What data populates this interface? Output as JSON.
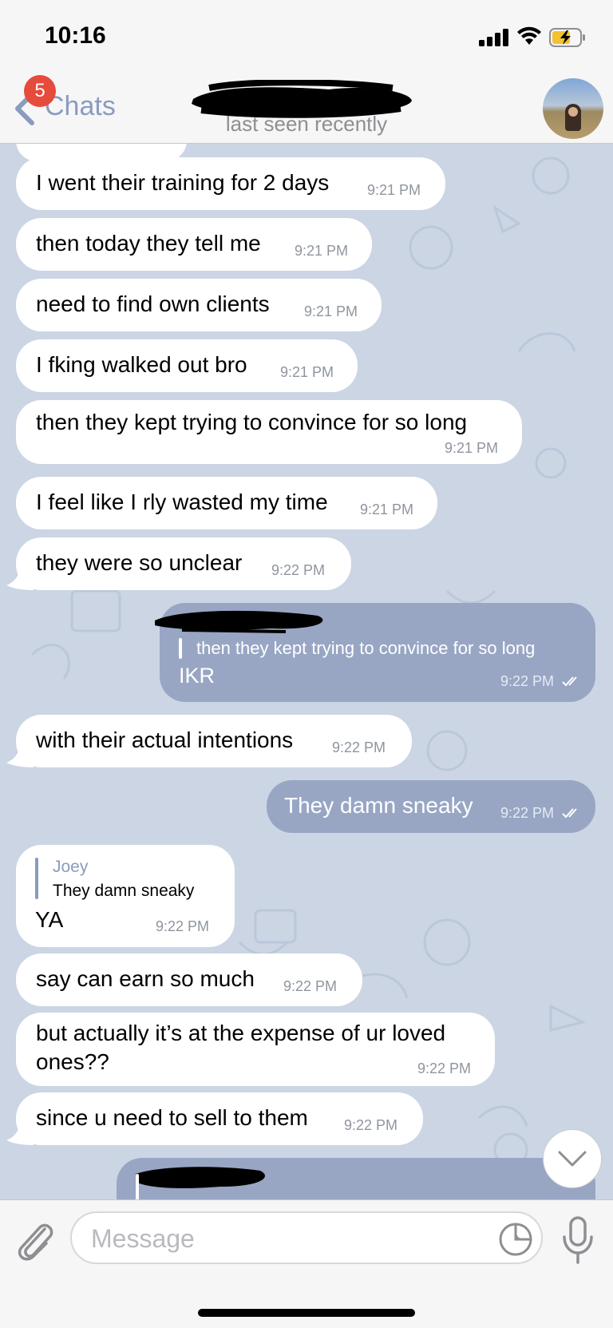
{
  "status_bar": {
    "time": "10:16"
  },
  "header": {
    "back_label": "Chats",
    "unread_badge": "5",
    "subtitle": "last seen recently"
  },
  "messages": [
    {
      "text": "I went their training for 2 days",
      "time": "9:21 PM",
      "direction": "incoming"
    },
    {
      "text": "then today they tell me",
      "time": "9:21 PM",
      "direction": "incoming"
    },
    {
      "text": "need to find own clients",
      "time": "9:21 PM",
      "direction": "incoming"
    },
    {
      "text": "I fking walked out bro",
      "time": "9:21 PM",
      "direction": "incoming"
    },
    {
      "text": "then they kept trying to convince for so long",
      "time": "9:21 PM",
      "direction": "incoming"
    },
    {
      "text": "I feel like I rly wasted my time",
      "time": "9:21 PM",
      "direction": "incoming"
    },
    {
      "text": "they were so unclear",
      "time": "9:22 PM",
      "direction": "incoming"
    },
    {
      "text": "IKR",
      "time": "9:22 PM",
      "direction": "outgoing",
      "reply_quote": "then they kept trying to convince for so long"
    },
    {
      "text": "with their actual intentions",
      "time": "9:22 PM",
      "direction": "incoming"
    },
    {
      "text": "They damn sneaky",
      "time": "9:22 PM",
      "direction": "outgoing"
    },
    {
      "text": "YA",
      "time": "9:22 PM",
      "direction": "incoming",
      "reply_author": "Joey",
      "reply_quote": "They damn sneaky"
    },
    {
      "text": "say can earn so much",
      "time": "9:22 PM",
      "direction": "incoming"
    },
    {
      "text_line1": "but actually it’s at the expense of ur loved",
      "text_line2": "ones??",
      "time": "9:22 PM",
      "direction": "incoming"
    },
    {
      "text": "since u need to sell to them",
      "time": "9:22 PM",
      "direction": "incoming"
    }
  ],
  "composer": {
    "placeholder": "Message"
  },
  "icons": {
    "back": "chevron-left-icon",
    "attach": "paperclip-icon",
    "sticker": "sticker-icon",
    "mic": "microphone-icon",
    "scroll_down": "chevron-down-icon"
  },
  "colors": {
    "accent": "#8a9bbf",
    "outgoing_bubble": "#98a6c4",
    "badge": "#e64b3b",
    "chat_background": "#cbd5e4"
  }
}
